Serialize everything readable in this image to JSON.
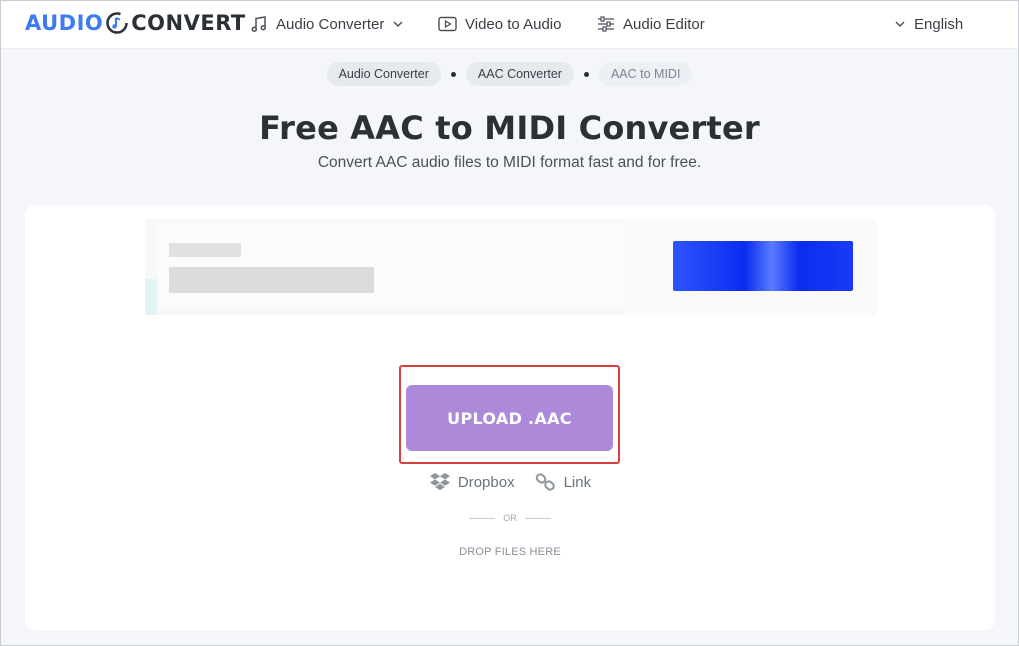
{
  "header": {
    "logo_left": "AUDIO",
    "logo_right": "CONVERT",
    "nav": [
      {
        "label": "Audio Converter",
        "icon": "music-note-icon",
        "has_dropdown": true
      },
      {
        "label": "Video to Audio",
        "icon": "play-icon"
      },
      {
        "label": "Audio Editor",
        "icon": "sliders-icon"
      }
    ],
    "language": "English"
  },
  "breadcrumb": [
    "Audio Converter",
    "AAC Converter",
    "AAC to MIDI"
  ],
  "title": "Free AAC to MIDI Converter",
  "subtitle": "Convert AAC audio files to MIDI format fast and for free.",
  "upload": {
    "button_label": "UPLOAD .AAC",
    "sources": [
      {
        "label": "Dropbox",
        "icon": "dropbox-icon"
      },
      {
        "label": "Link",
        "icon": "link-icon"
      }
    ],
    "or_label": "OR",
    "drop_label": "DROP FILES HERE"
  },
  "colors": {
    "brand_blue": "#3d7cf0",
    "upload_button": "#ad8ad9",
    "highlight_border": "#d94141"
  }
}
